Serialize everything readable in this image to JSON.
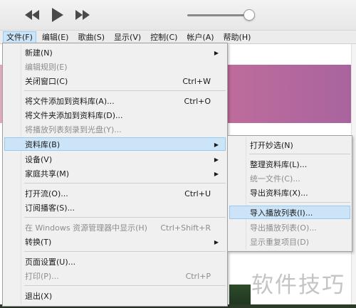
{
  "menubar": {
    "items": [
      "文件(F)",
      "编辑(E)",
      "歌曲(S)",
      "显示(V)",
      "控制(C)",
      "帐户(A)",
      "帮助(H)"
    ]
  },
  "file_menu": {
    "items": [
      {
        "label": "新建(N)",
        "submenu": true
      },
      {
        "label": "编辑规则(E)",
        "disabled": true
      },
      {
        "label": "关闭窗口(C)",
        "shortcut": "Ctrl+W"
      },
      {
        "label": "将文件添加到资料库(A)...",
        "shortcut": "Ctrl+O"
      },
      {
        "label": "将文件夹添加到资料库(D)..."
      },
      {
        "label": "将播放列表刻录到光盘(Y)...",
        "disabled": true
      },
      {
        "label": "资料库(B)",
        "submenu": true,
        "highlighted": true
      },
      {
        "label": "设备(V)",
        "submenu": true
      },
      {
        "label": "家庭共享(M)",
        "submenu": true
      },
      {
        "label": "打开流(O)...",
        "shortcut": "Ctrl+U"
      },
      {
        "label": "订阅播客(S)..."
      },
      {
        "label": "在 Windows 资源管理器中显示(H)",
        "shortcut": "Ctrl+Shift+R",
        "disabled": true
      },
      {
        "label": "转换(T)",
        "submenu": true
      },
      {
        "label": "页面设置(U)..."
      },
      {
        "label": "打印(P)...",
        "shortcut": "Ctrl+P",
        "disabled": true
      },
      {
        "label": "退出(X)"
      }
    ]
  },
  "library_submenu": {
    "items": [
      {
        "label": "打开妙选(N)"
      },
      {
        "label": "整理资料库(L)..."
      },
      {
        "label": "统一文件(C)...",
        "disabled": true
      },
      {
        "label": "导出资料库(X)..."
      },
      {
        "label": "导入播放列表(I)...",
        "highlighted": true
      },
      {
        "label": "导出播放列表(O)...",
        "disabled": true
      },
      {
        "label": "显示重复项目(D)",
        "disabled": true
      }
    ]
  },
  "player": {
    "volume_level": 0.9,
    "icons": [
      "rewind-icon",
      "play-icon",
      "fast-forward-icon"
    ]
  },
  "watermark": "软件技巧",
  "colors": {
    "highlight": "#cce4f7",
    "highlight_border": "#99c9ef",
    "menu_bg": "#f0f0f0",
    "disabled_text": "#8d8d8d"
  }
}
